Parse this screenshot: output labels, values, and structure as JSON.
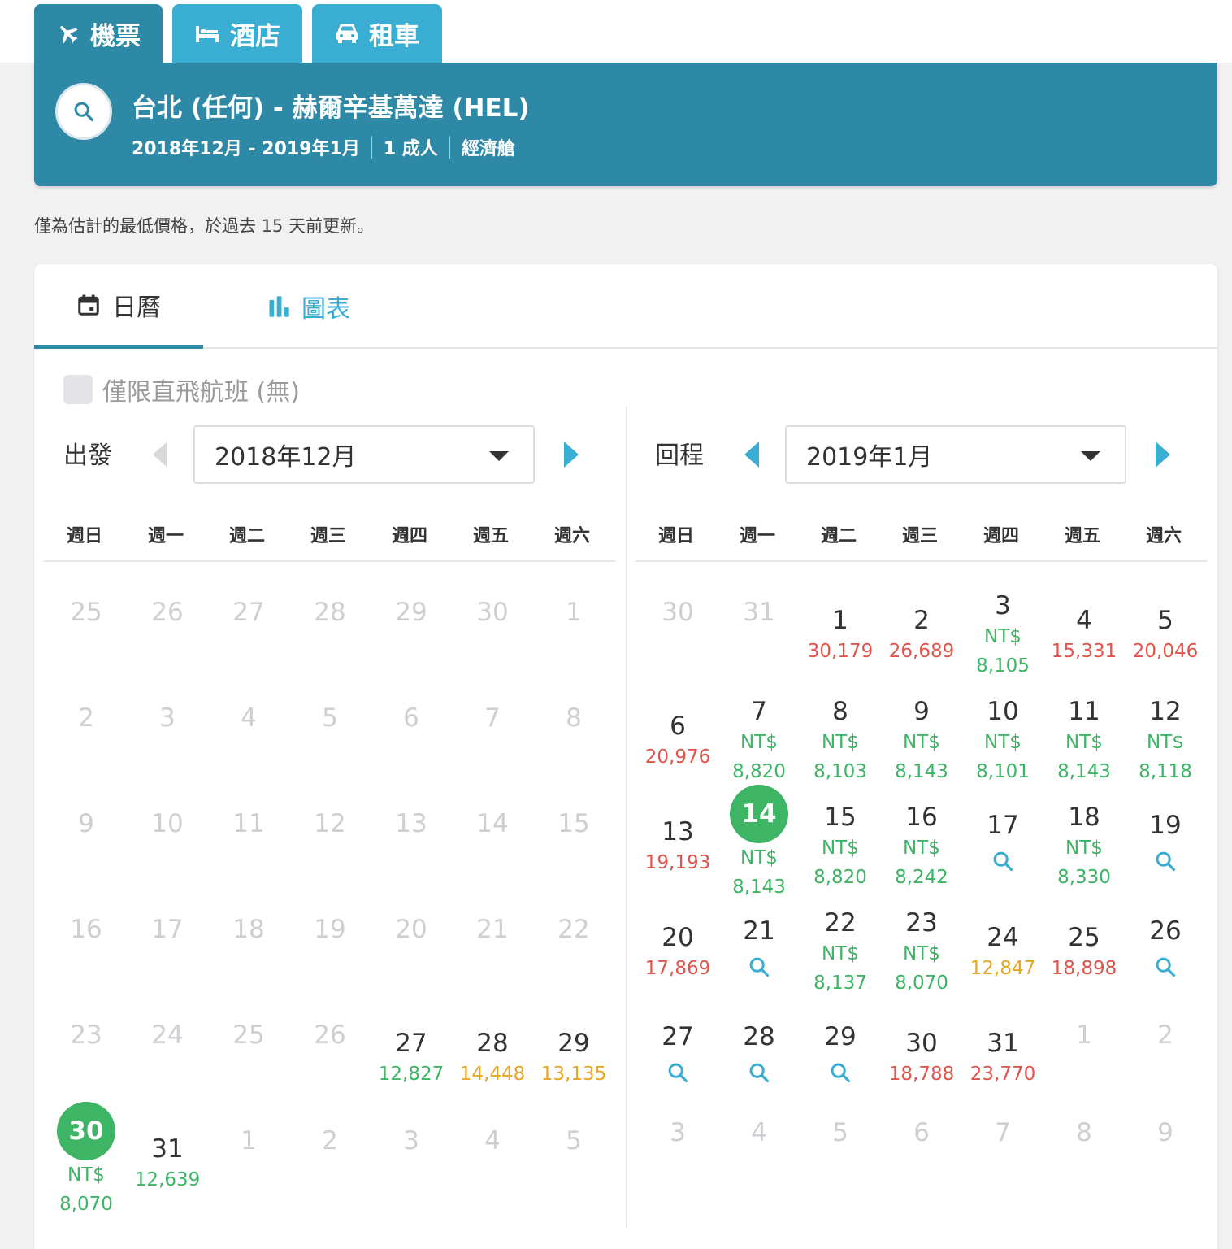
{
  "tabs": [
    {
      "label": "機票",
      "icon": "plane-icon"
    },
    {
      "label": "酒店",
      "icon": "bed-icon"
    },
    {
      "label": "租車",
      "icon": "car-icon"
    }
  ],
  "search": {
    "route": "台北 (任何) - 赫爾辛基萬達 (HEL)",
    "date_range": "2018年12月 - 2019年1月",
    "passengers": "1 成人",
    "cabin": "經濟艙"
  },
  "note": "僅為估計的最低價格，於過去 15 天前更新。",
  "view_tabs": [
    {
      "label": "日曆",
      "icon": "calendar-icon"
    },
    {
      "label": "圖表",
      "icon": "bar-chart-icon"
    }
  ],
  "direct_only": {
    "label": "僅限直飛航班 (無)",
    "checked": false
  },
  "weekdays": [
    "週日",
    "週一",
    "週二",
    "週三",
    "週四",
    "週五",
    "週六"
  ],
  "colors": {
    "green": "#3db565",
    "red": "#e0544b",
    "orange": "#e8a623",
    "brand": "#2e89a7",
    "accent": "#3aaed2"
  },
  "calendars": [
    {
      "label": "出發",
      "month": "2018年12月",
      "prev_enabled": false,
      "rows": [
        [
          {
            "d": "25",
            "dim": true
          },
          {
            "d": "26",
            "dim": true
          },
          {
            "d": "27",
            "dim": true
          },
          {
            "d": "28",
            "dim": true
          },
          {
            "d": "29",
            "dim": true
          },
          {
            "d": "30",
            "dim": true
          },
          {
            "d": "1",
            "dim": true
          }
        ],
        [
          {
            "d": "2",
            "dim": true
          },
          {
            "d": "3",
            "dim": true
          },
          {
            "d": "4",
            "dim": true
          },
          {
            "d": "5",
            "dim": true
          },
          {
            "d": "6",
            "dim": true
          },
          {
            "d": "7",
            "dim": true
          },
          {
            "d": "8",
            "dim": true
          }
        ],
        [
          {
            "d": "9",
            "dim": true
          },
          {
            "d": "10",
            "dim": true
          },
          {
            "d": "11",
            "dim": true
          },
          {
            "d": "12",
            "dim": true
          },
          {
            "d": "13",
            "dim": true
          },
          {
            "d": "14",
            "dim": true
          },
          {
            "d": "15",
            "dim": true
          }
        ],
        [
          {
            "d": "16",
            "dim": true
          },
          {
            "d": "17",
            "dim": true
          },
          {
            "d": "18",
            "dim": true
          },
          {
            "d": "19",
            "dim": true
          },
          {
            "d": "20",
            "dim": true
          },
          {
            "d": "21",
            "dim": true
          },
          {
            "d": "22",
            "dim": true
          }
        ],
        [
          {
            "d": "23",
            "dim": true
          },
          {
            "d": "24",
            "dim": true
          },
          {
            "d": "25",
            "dim": true
          },
          {
            "d": "26",
            "dim": true
          },
          {
            "d": "27",
            "p": "12,827",
            "c": "green"
          },
          {
            "d": "28",
            "p": "14,448",
            "c": "orange"
          },
          {
            "d": "29",
            "p": "13,135",
            "c": "orange"
          }
        ],
        [
          {
            "d": "30",
            "sel": true,
            "cur": "NT$",
            "p": "8,070",
            "c": "green"
          },
          {
            "d": "31",
            "p": "12,639",
            "c": "green"
          },
          {
            "d": "1",
            "dim": true
          },
          {
            "d": "2",
            "dim": true
          },
          {
            "d": "3",
            "dim": true
          },
          {
            "d": "4",
            "dim": true
          },
          {
            "d": "5",
            "dim": true
          }
        ]
      ]
    },
    {
      "label": "回程",
      "month": "2019年1月",
      "prev_enabled": true,
      "rows": [
        [
          {
            "d": "30",
            "dim": true
          },
          {
            "d": "31",
            "dim": true
          },
          {
            "d": "1",
            "p": "30,179",
            "c": "red"
          },
          {
            "d": "2",
            "p": "26,689",
            "c": "red"
          },
          {
            "d": "3",
            "cur": "NT$",
            "p": "8,105",
            "c": "green"
          },
          {
            "d": "4",
            "p": "15,331",
            "c": "red"
          },
          {
            "d": "5",
            "p": "20,046",
            "c": "red"
          }
        ],
        [
          {
            "d": "6",
            "p": "20,976",
            "c": "red"
          },
          {
            "d": "7",
            "cur": "NT$",
            "p": "8,820",
            "c": "green"
          },
          {
            "d": "8",
            "cur": "NT$",
            "p": "8,103",
            "c": "green"
          },
          {
            "d": "9",
            "cur": "NT$",
            "p": "8,143",
            "c": "green"
          },
          {
            "d": "10",
            "cur": "NT$",
            "p": "8,101",
            "c": "green"
          },
          {
            "d": "11",
            "cur": "NT$",
            "p": "8,143",
            "c": "green"
          },
          {
            "d": "12",
            "cur": "NT$",
            "p": "8,118",
            "c": "green"
          }
        ],
        [
          {
            "d": "13",
            "p": "19,193",
            "c": "red"
          },
          {
            "d": "14",
            "sel": true,
            "cur": "NT$",
            "p": "8,143",
            "c": "green"
          },
          {
            "d": "15",
            "cur": "NT$",
            "p": "8,820",
            "c": "green"
          },
          {
            "d": "16",
            "cur": "NT$",
            "p": "8,242",
            "c": "green"
          },
          {
            "d": "17",
            "search": true
          },
          {
            "d": "18",
            "cur": "NT$",
            "p": "8,330",
            "c": "green"
          },
          {
            "d": "19",
            "search": true
          }
        ],
        [
          {
            "d": "20",
            "p": "17,869",
            "c": "red"
          },
          {
            "d": "21",
            "search": true
          },
          {
            "d": "22",
            "cur": "NT$",
            "p": "8,137",
            "c": "green"
          },
          {
            "d": "23",
            "cur": "NT$",
            "p": "8,070",
            "c": "green"
          },
          {
            "d": "24",
            "p": "12,847",
            "c": "orange"
          },
          {
            "d": "25",
            "p": "18,898",
            "c": "red"
          },
          {
            "d": "26",
            "search": true
          }
        ],
        [
          {
            "d": "27",
            "search": true
          },
          {
            "d": "28",
            "search": true
          },
          {
            "d": "29",
            "search": true
          },
          {
            "d": "30",
            "p": "18,788",
            "c": "red"
          },
          {
            "d": "31",
            "p": "23,770",
            "c": "red"
          },
          {
            "d": "1",
            "dim": true
          },
          {
            "d": "2",
            "dim": true
          }
        ],
        [
          {
            "d": "3",
            "dim": true
          },
          {
            "d": "4",
            "dim": true
          },
          {
            "d": "5",
            "dim": true
          },
          {
            "d": "6",
            "dim": true
          },
          {
            "d": "7",
            "dim": true
          },
          {
            "d": "8",
            "dim": true
          },
          {
            "d": "9",
            "dim": true
          }
        ]
      ]
    }
  ]
}
